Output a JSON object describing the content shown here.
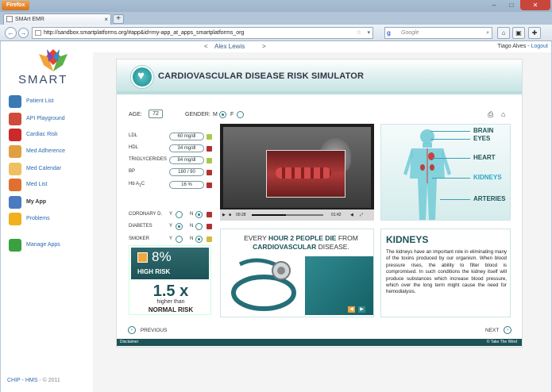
{
  "browser": {
    "app_button": "Firefox",
    "tab_title": "SMArt EMR",
    "url": "http://sandbox.smartplatforms.org/#app&id=my-app_at_apps_smartplatforms_org",
    "search_placeholder": "Google",
    "new_tab": "+",
    "close_tab": "×",
    "back": "←",
    "forward": "→",
    "minimize": "–",
    "maximize": "□",
    "close": "✕"
  },
  "header": {
    "prev_patient": "<",
    "patient_name": "Alex Lewis",
    "next_patient": ">",
    "user_name": "Tiago Alves",
    "separator": "-",
    "logout": "Logout"
  },
  "logo": {
    "text": "SMART"
  },
  "sidebar": {
    "items": [
      {
        "label": "Patient List",
        "icon": "magnifier-icon",
        "color": "#3a7ab5"
      },
      {
        "label": "API Playground",
        "icon": "blocks-icon",
        "color": "#d04a3a"
      },
      {
        "label": "Cardiac Risk",
        "icon": "heart-icon",
        "color": "#cc2a2a"
      },
      {
        "label": "Med Adherence",
        "icon": "chart-icon",
        "color": "#e0a040"
      },
      {
        "label": "Med Calendar",
        "icon": "calendar-icon",
        "color": "#f0c060"
      },
      {
        "label": "Med List",
        "icon": "pill-icon",
        "color": "#e07030"
      },
      {
        "label": "My App",
        "icon": "app-icon",
        "color": "#4a7ac0"
      },
      {
        "label": "Problems",
        "icon": "warning-icon",
        "color": "#f0b020"
      },
      {
        "label": "Manage Apps",
        "icon": "plus-icon",
        "color": "#3aa040"
      }
    ],
    "active_index": 6
  },
  "footer": {
    "link": "CHIP - HMS",
    "copyright": "- © 2011"
  },
  "app": {
    "title": "CARDIOVASCULAR DISEASE RISK SIMULATOR",
    "age_label": "AGE:",
    "age_value": "72",
    "gender_label": "GENDER:",
    "gender_m": "M",
    "gender_f": "F",
    "labs": [
      {
        "label": "LDL",
        "value": "60 mg/dl",
        "status": "g"
      },
      {
        "label": "HDL",
        "value": "34 mg/dl",
        "status": "r"
      },
      {
        "label": "TRIGLYCERIDES",
        "value": "84 mg/dl",
        "status": "g"
      },
      {
        "label": "BP",
        "value": "180 / 90",
        "status": "r"
      },
      {
        "label": "Hb A",
        "label_sub": "1",
        "label_suffix": "C",
        "value": "16 %",
        "status": "r"
      }
    ],
    "conditions": [
      {
        "label": "CORONARY D.",
        "y": "Y",
        "n": "N",
        "selected": "n",
        "status": "r"
      },
      {
        "label": "DIABETES",
        "y": "Y",
        "n": "N",
        "selected": "y",
        "status": "r"
      },
      {
        "label": "SMOKER",
        "y": "Y",
        "n": "N",
        "selected": "n",
        "status": "y"
      }
    ],
    "risk": {
      "percent": "8%",
      "level": "HIGH RISK",
      "multiplier": "1.5 x",
      "compare_text": "higher than",
      "compare_level": "NORMAL RISK"
    },
    "video": {
      "time_current": "00:28",
      "time_total": "01:42",
      "progress": 0.48
    },
    "fact": {
      "p1": "EVERY ",
      "b1": "HOUR 2 PEOPLE DIE",
      "p2": " FROM ",
      "b2": "CARDIOVASCULAR",
      "p3": " DISEASE."
    },
    "organs": [
      {
        "label": "BRAIN",
        "selected": false
      },
      {
        "label": "EYES",
        "selected": false
      },
      {
        "label": "HEART",
        "selected": false
      },
      {
        "label": "KIDNEYS",
        "selected": true
      },
      {
        "label": "ARTERIES",
        "selected": false
      }
    ],
    "info": {
      "heading": "KIDNEYS",
      "text": "The kidneys have an important role in eliminating many of the toxins produced by our organism. When blood pressure rises, the ability to filter blood is compromised. In such conditions the kidney itself will produce substances which increase blood pressure, which over the long term might cause the need for hemodialysis."
    },
    "nav": {
      "previous": "PREVIOUS",
      "next": "NEXT"
    },
    "bottom": {
      "disclaimer": "Disclaimer",
      "credit": "© Take The Wind"
    }
  }
}
